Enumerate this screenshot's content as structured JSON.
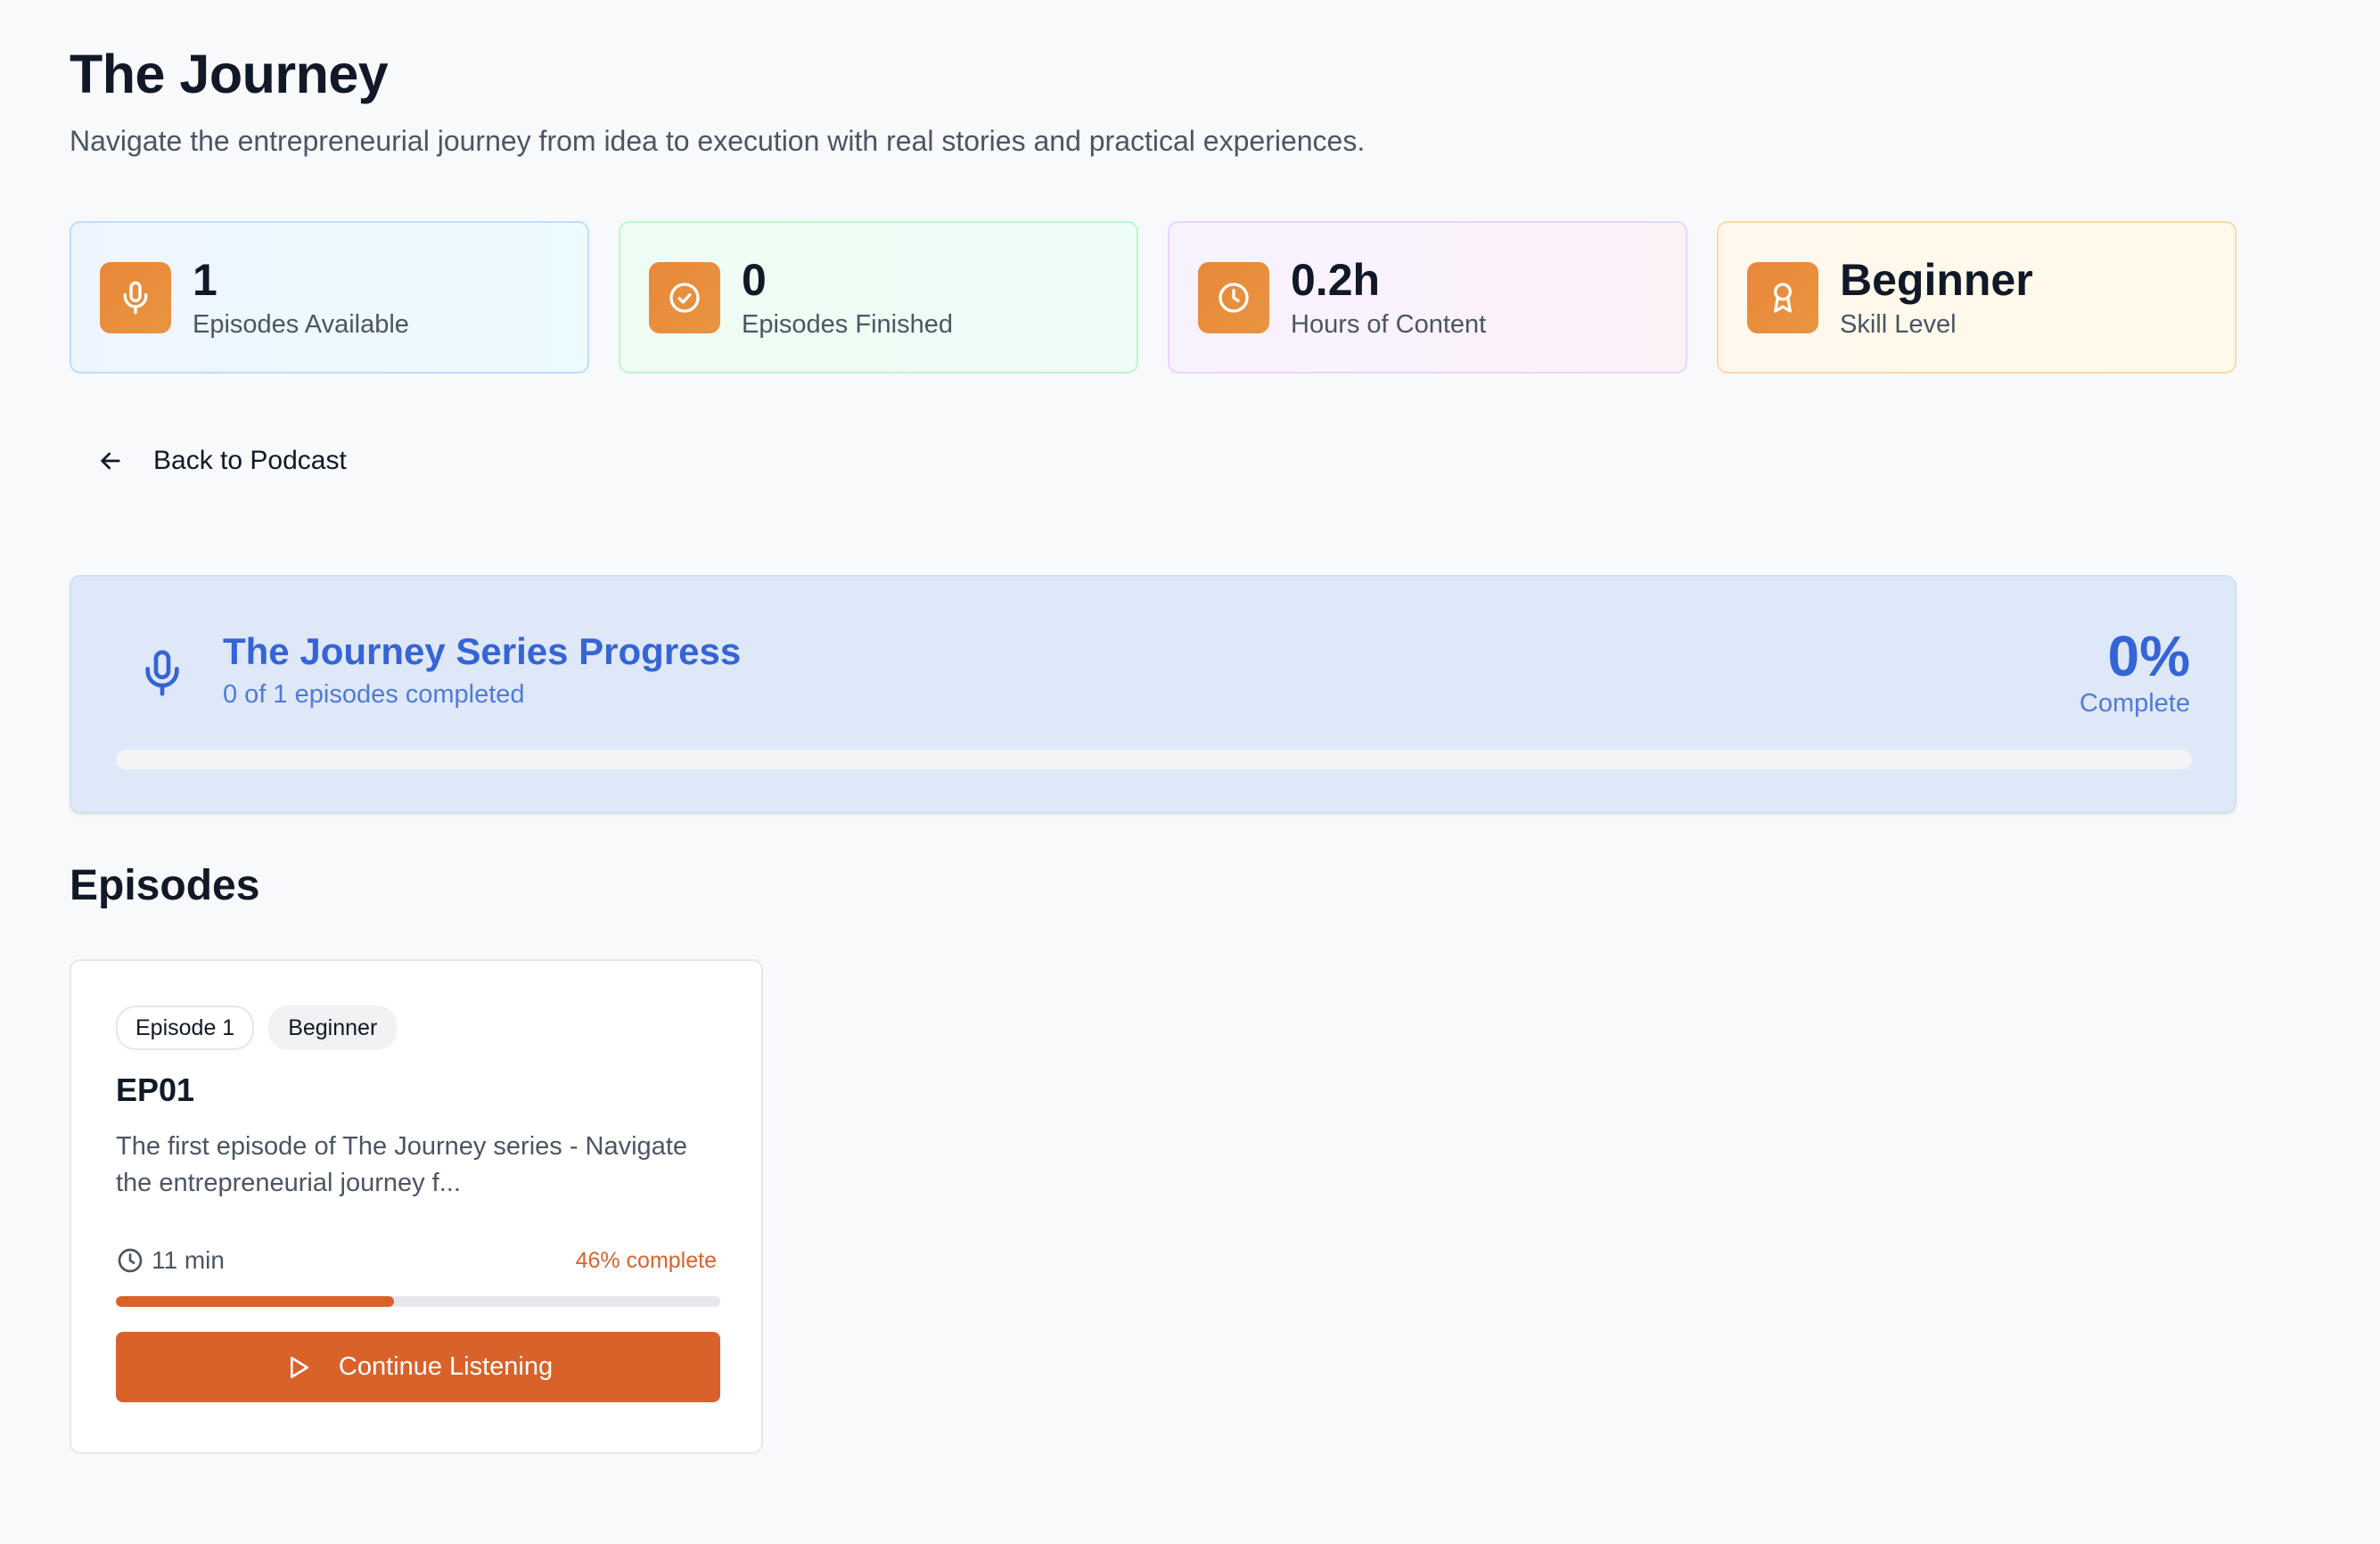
{
  "header": {
    "title": "The Journey",
    "subtitle": "Navigate the entrepreneurial journey from idea to execution with real stories and practical experiences."
  },
  "stats": [
    {
      "value": "1",
      "label": "Episodes Available",
      "icon": "microphone-icon"
    },
    {
      "value": "0",
      "label": "Episodes Finished",
      "icon": "check-circle-icon"
    },
    {
      "value": "0.2h",
      "label": "Hours of Content",
      "icon": "clock-icon"
    },
    {
      "value": "Beginner",
      "label": "Skill Level",
      "icon": "award-icon"
    }
  ],
  "back_link": {
    "label": "Back to Podcast",
    "icon": "arrow-left-icon"
  },
  "series_progress": {
    "title": "The Journey Series Progress",
    "subtitle": "0 of 1 episodes completed",
    "percent_label": "0%",
    "complete_label": "Complete",
    "fraction": 0,
    "color": "#3564d6"
  },
  "episodes_section": {
    "title": "Episodes"
  },
  "episodes": [
    {
      "badge_number": "Episode 1",
      "badge_level": "Beginner",
      "title": "EP01",
      "description": "The first episode of The Journey series - Navigate the entrepreneurial journey f...",
      "duration": "11 min",
      "progress_label": "46% complete",
      "progress_fraction": 0.46,
      "button_label": "Continue Listening",
      "accent": "#d9622b"
    }
  ]
}
